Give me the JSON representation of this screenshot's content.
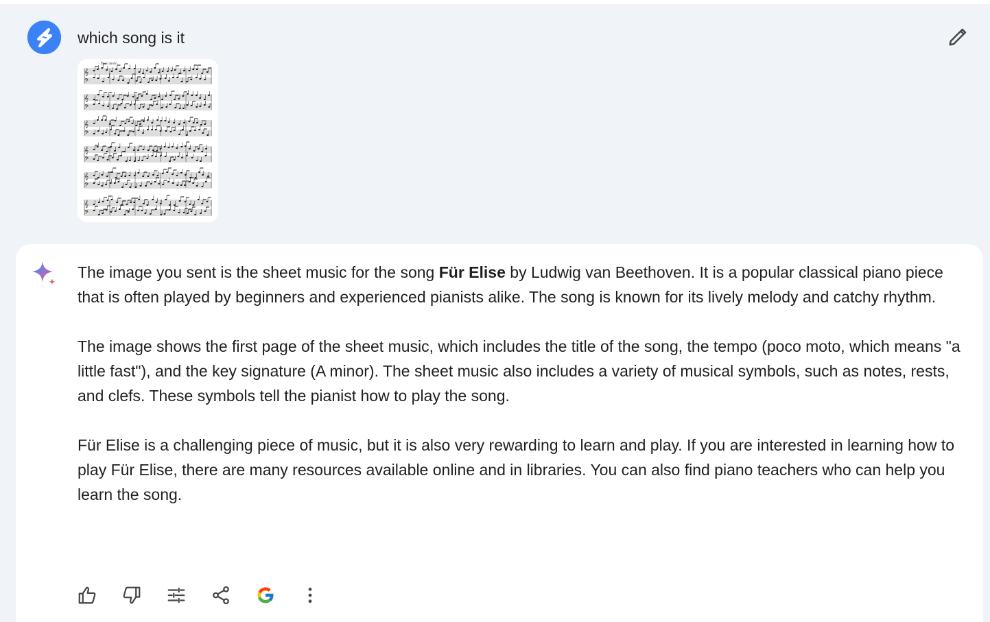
{
  "user_prompt": {
    "text": "which song is it",
    "avatar_icon": "user-avatar-icon",
    "edit_icon": "pencil-icon",
    "attachment": {
      "title": "Poco moto"
    }
  },
  "response": {
    "icon": "sparkle-icon",
    "paragraphs": [
      {
        "pre": "The image you sent is the sheet music for the song ",
        "bold": "Für Elise",
        "post": " by Ludwig van Beethoven. It is a popular classical piano piece that is often played by beginners and experienced pianists alike. The song is known for its lively melody and catchy rhythm."
      },
      {
        "text": "The image shows the first page of the sheet music, which includes the title of the song, the tempo (poco moto, which means \"a little fast\"), and the key signature (A minor). The sheet music also includes a variety of musical symbols, such as notes, rests, and clefs. These symbols tell the pianist how to play the song."
      },
      {
        "text": "Für Elise is a challenging piece of music, but it is also very rewarding to learn and play. If you are interested in learning how to play Für Elise, there are many resources available online and in libraries. You can also find piano teachers who can help you learn the song."
      }
    ],
    "actions": [
      "thumbs-up-icon",
      "thumbs-down-icon",
      "tune-icon",
      "share-icon",
      "google-icon",
      "more-vert-icon"
    ]
  },
  "colors": {
    "background": "#f0f4f9",
    "card": "#ffffff",
    "text": "#1f1f1f",
    "avatar": "#3b82f6"
  }
}
